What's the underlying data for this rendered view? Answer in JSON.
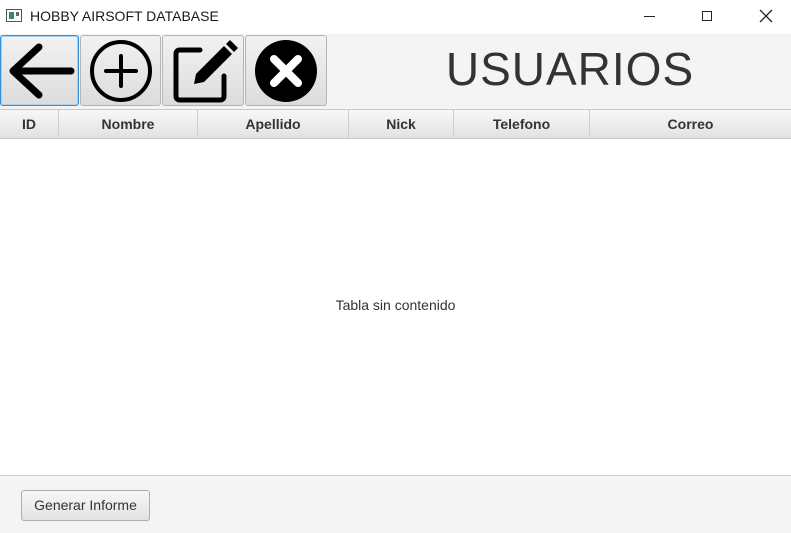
{
  "window": {
    "title": "HOBBY AIRSOFT DATABASE"
  },
  "toolbar": {
    "buttons": [
      {
        "name": "back",
        "icon": "arrow-left-icon"
      },
      {
        "name": "add",
        "icon": "plus-circle-icon"
      },
      {
        "name": "edit",
        "icon": "edit-icon"
      },
      {
        "name": "delete",
        "icon": "close-circle-icon"
      }
    ],
    "title": "USUARIOS"
  },
  "table": {
    "columns": [
      "ID",
      "Nombre",
      "Apellido",
      "Nick",
      "Telefono",
      "Correo"
    ],
    "rows": [],
    "empty_text": "Tabla sin contenido"
  },
  "footer": {
    "report_button_label": "Generar Informe"
  },
  "colors": {
    "focus_border": "#2f8fd8",
    "background": "#f4f4f4"
  }
}
